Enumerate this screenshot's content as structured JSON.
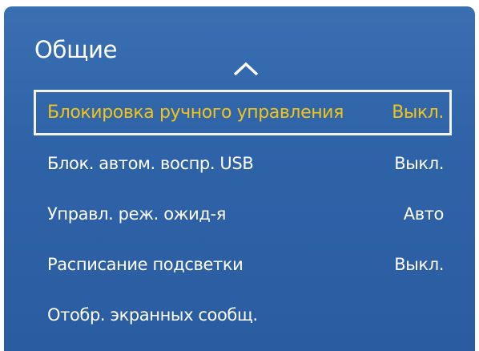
{
  "menu": {
    "title": "Общие",
    "scroll_up_icon": "chevron-up-icon",
    "items": [
      {
        "label": "Блокировка ручного управления",
        "value": "Выкл.",
        "selected": true
      },
      {
        "label": "Блок. автом. воспр. USB",
        "value": "Выкл.",
        "selected": false
      },
      {
        "label": "Управл. реж. ожид-я",
        "value": "Авто",
        "selected": false
      },
      {
        "label": "Расписание подсветки",
        "value": "Выкл.",
        "selected": false
      },
      {
        "label": "Отобр. экранных сообщ.",
        "value": "",
        "selected": false
      }
    ]
  },
  "colors": {
    "panel_background": "#2f63a8",
    "text": "#ffffff",
    "selected_text": "#f2c416",
    "selected_border": "#f4f1e6"
  }
}
